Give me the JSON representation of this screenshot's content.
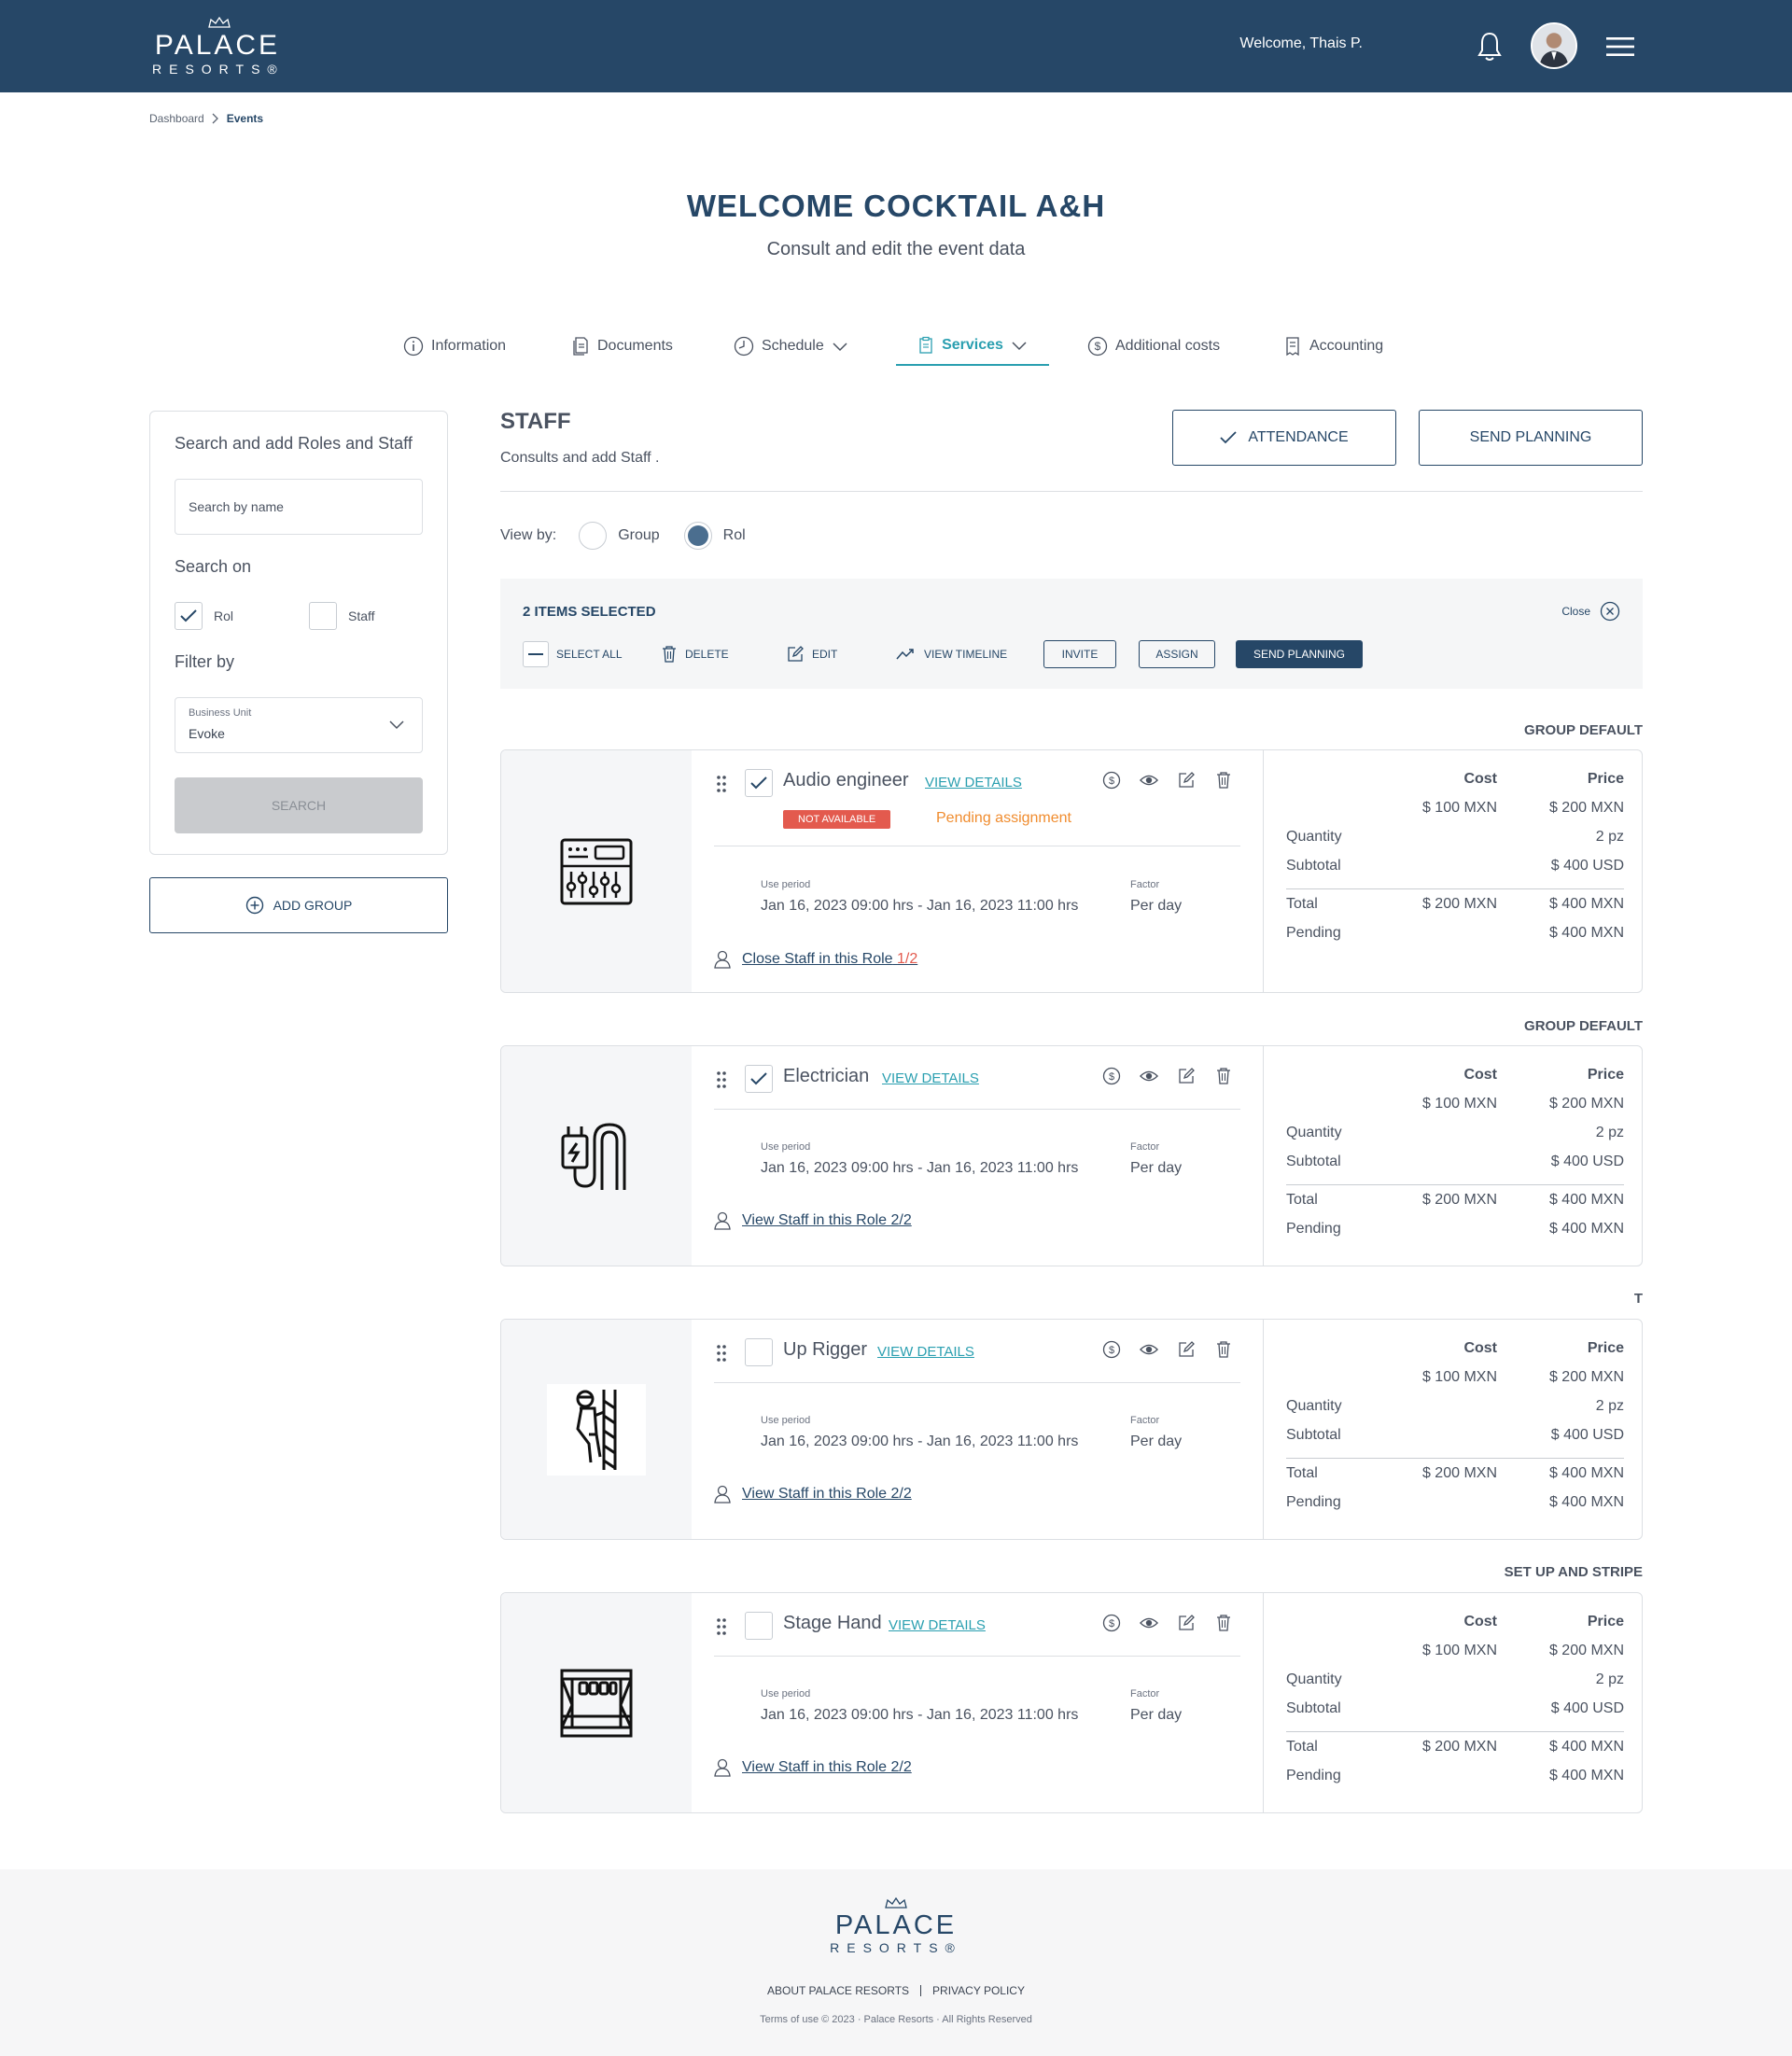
{
  "header": {
    "brand": "PALACE",
    "brand_sub": "RESORTS®",
    "welcome": "Welcome, Thais P."
  },
  "breadcrumb": [
    "Dashboard",
    "Events"
  ],
  "page": {
    "title": "WELCOME COCKTAIL A&H",
    "subtitle": "Consult and edit the event data"
  },
  "tabs": [
    {
      "label": "Information",
      "icon": "info-icon"
    },
    {
      "label": "Documents",
      "icon": "documents-icon"
    },
    {
      "label": "Schedule",
      "icon": "clock-icon"
    },
    {
      "label": "Services",
      "icon": "clipboard-icon",
      "active": true
    },
    {
      "label": "Additional costs",
      "icon": "dollar-icon"
    },
    {
      "label": "Accounting",
      "icon": "receipt-icon"
    }
  ],
  "search_panel": {
    "title": "Search and add Roles and Staff",
    "search_placeholder": "Search by name",
    "search_on_label": "Search on",
    "option_rol": "Rol",
    "option_staff": "Staff",
    "filter_by_label": "Filter by",
    "business_unit_label": "Business Unit",
    "business_unit_value": "Evoke",
    "search_button": "SEARCH",
    "add_group": "ADD GROUP"
  },
  "staff": {
    "title": "STAFF",
    "subtitle": "Consults and add Staff .",
    "attendance": "ATTENDANCE",
    "send_planning": "SEND PLANNING",
    "view_by_label": "View by:",
    "view_group": "Group",
    "view_rol": "Rol"
  },
  "selection": {
    "count": "2 ITEMS SELECTED",
    "close": "Close",
    "select_all": "SELECT ALL",
    "delete": "DELETE",
    "edit": "EDIT",
    "view_timeline": "VIEW TIMELINE",
    "invite": "INVITE",
    "assign": "ASSIGN",
    "send_planning": "SEND PLANNING"
  },
  "labels": {
    "view_details": "VIEW DETAILS",
    "use_period": "Use period",
    "factor": "Factor",
    "cost": "Cost",
    "price": "Price",
    "quantity": "Quantity",
    "subtotal": "Subtotal",
    "total": "Total",
    "pending": "Pending",
    "not_available": "NOT AVAILABLE",
    "pending_assignment": "Pending assignment"
  },
  "cards": [
    {
      "group": "GROUP DEFAULT",
      "role": "Audio engineer",
      "checked": true,
      "icon": "mixer-console-icon",
      "period": "Jan 16, 2023 09:00 hrs - Jan 16, 2023 11:00 hrs",
      "factor": "Per day",
      "link_text": "Close Staff in this Role",
      "link_count": "1/2",
      "cost": "$ 100 MXN",
      "price": "$ 200 MXN",
      "quantity": "2 pz",
      "subtotal": "$ 400 USD",
      "total_cost": "$ 200 MXN",
      "total_price": "$ 400 MXN",
      "pending": "$ 400 MXN"
    },
    {
      "group": "GROUP DEFAULT",
      "role": "Electrician",
      "checked": true,
      "icon": "power-cable-icon",
      "period": "Jan 16, 2023 09:00 hrs - Jan 16, 2023 11:00 hrs",
      "factor": "Per day",
      "link_text": "View Staff in this Role 2/2",
      "cost": "$ 100 MXN",
      "price": "$ 200 MXN",
      "quantity": "2 pz",
      "subtotal": "$ 400 USD",
      "total_cost": "$ 200 MXN",
      "total_price": "$ 400 MXN",
      "pending": "$ 400 MXN"
    },
    {
      "group": "T",
      "role": "Up Rigger",
      "checked": false,
      "icon": "rigger-climbing-icon",
      "period": "Jan 16, 2023 09:00 hrs - Jan 16, 2023 11:00 hrs",
      "factor": "Per day",
      "link_text": "View Staff in this Role 2/2",
      "cost": "$ 100 MXN",
      "price": "$ 200 MXN",
      "quantity": "2 pz",
      "subtotal": "$ 400 USD",
      "total_cost": "$ 200 MXN",
      "total_price": "$ 400 MXN",
      "pending": "$ 400 MXN"
    },
    {
      "group": "SET UP AND STRIPE",
      "role": "Stage Hand",
      "checked": false,
      "icon": "stage-icon",
      "period": "Jan 16, 2023 09:00 hrs - Jan 16, 2023 11:00 hrs",
      "factor": "Per day",
      "link_text": "View Staff in this Role 2/2",
      "cost": "$ 100 MXN",
      "price": "$ 200 MXN",
      "quantity": "2 pz",
      "subtotal": "$ 400 USD",
      "total_cost": "$ 200 MXN",
      "total_price": "$ 400 MXN",
      "pending": "$ 400 MXN"
    }
  ],
  "footer": {
    "brand": "PALACE",
    "brand_sub": "RESORTS®",
    "about": "ABOUT PALACE RESORTS",
    "privacy": "PRIVACY POLICY",
    "copyright": "Terms of use © 2023 · Palace Resorts · All Rights Reserved"
  }
}
